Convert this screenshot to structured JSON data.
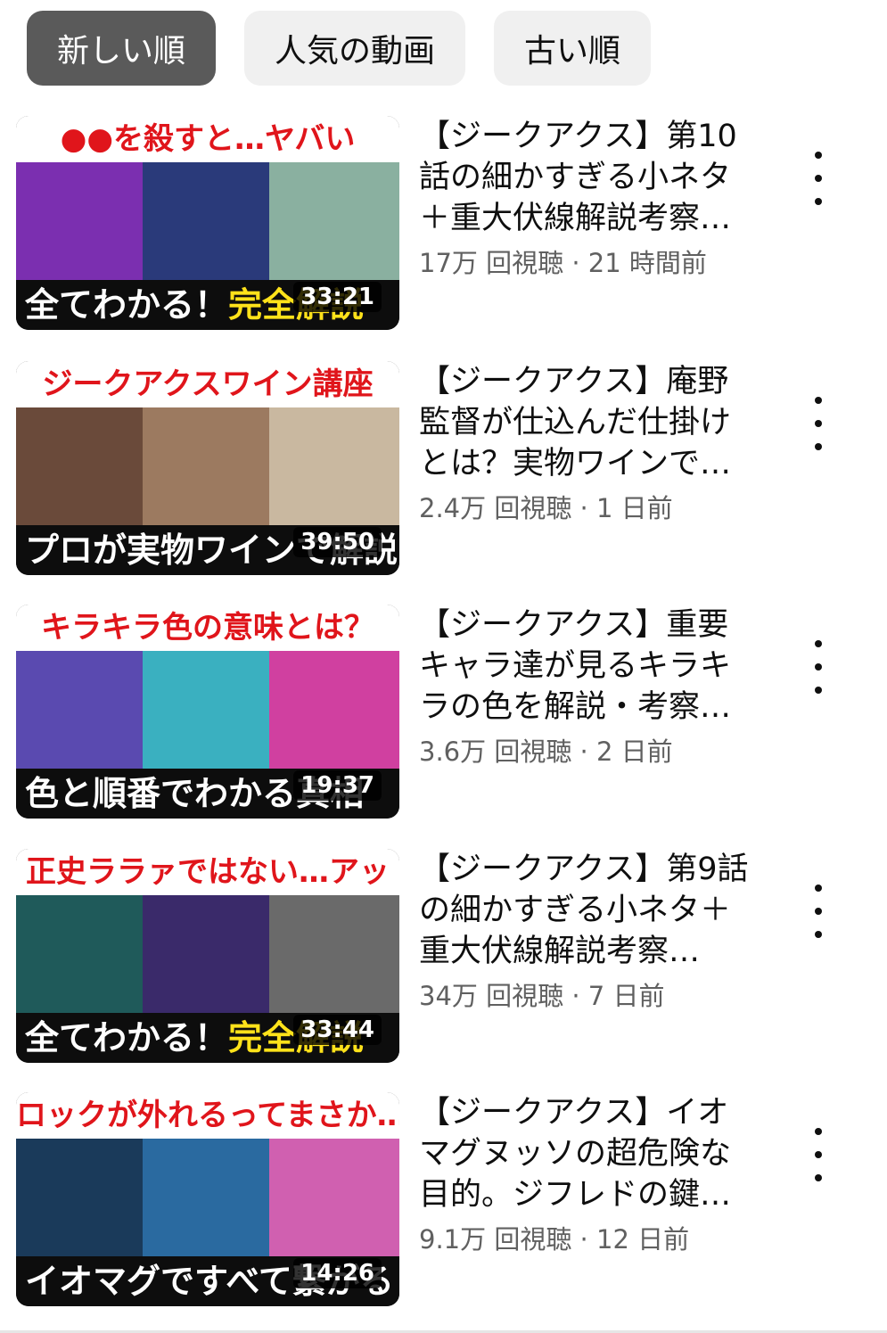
{
  "filter_chips": [
    {
      "label": "新しい順",
      "active": true
    },
    {
      "label": "人気の動画",
      "active": false
    },
    {
      "label": "古い順",
      "active": false
    }
  ],
  "videos": [
    {
      "thumbnail_headline": "●●を殺すと…ヤバい",
      "thumbnail_caption_white": "全てわかる！",
      "thumbnail_caption_yellow": "完全解説",
      "duration": "33:21",
      "title": "【ジークアクス】第10話の細かすぎる小ネタ＋重大伏線解説考察…",
      "stats": "17万 回視聴 · 21 時間前",
      "art_colors": [
        "#7b2fb0",
        "#2a3a7a",
        "#8ab0a0"
      ]
    },
    {
      "thumbnail_headline": "ジークアクスワイン講座",
      "thumbnail_caption_white": "プロが実物ワインで解説",
      "thumbnail_caption_yellow": "",
      "duration": "39:50",
      "title": "【ジークアクス】庵野監督が仕込んだ仕掛けとは？実物ワインで…",
      "stats": "2.4万 回視聴 · 1 日前",
      "art_colors": [
        "#6a4a3a",
        "#9c7a60",
        "#c9b8a0"
      ]
    },
    {
      "thumbnail_headline": "キラキラ色の意味とは？",
      "thumbnail_caption_white": "色と順番でわかる真相",
      "thumbnail_caption_yellow": "",
      "duration": "19:37",
      "title": "【ジークアクス】重要キャラ達が見るキラキラの色を解説・考察…",
      "stats": "3.6万 回視聴 · 2 日前",
      "art_colors": [
        "#5a4ab0",
        "#3ab0c0",
        "#d040a0"
      ]
    },
    {
      "thumbnail_headline": "正史ララァではない…アッ",
      "thumbnail_caption_white": "全てわかる！",
      "thumbnail_caption_yellow": "完全解説",
      "duration": "33:44",
      "title": "【ジークアクス】第9話の細かすぎる小ネタ＋重大伏線解説考察…",
      "stats": "34万 回視聴 · 7 日前",
      "art_colors": [
        "#1f5a5a",
        "#3a2a6a",
        "#6a6a6a"
      ]
    },
    {
      "thumbnail_headline": "ロックが外れるってまさか…",
      "thumbnail_caption_white": "イオマグですべて繋がる",
      "thumbnail_caption_yellow": "",
      "duration": "14:26",
      "title": "【ジークアクス】イオマグヌッソの超危険な目的。ジフレドの鍵…",
      "stats": "9.1万 回視聴 · 12 日前",
      "art_colors": [
        "#1a3a5a",
        "#2a6aa0",
        "#d060b0"
      ]
    }
  ]
}
